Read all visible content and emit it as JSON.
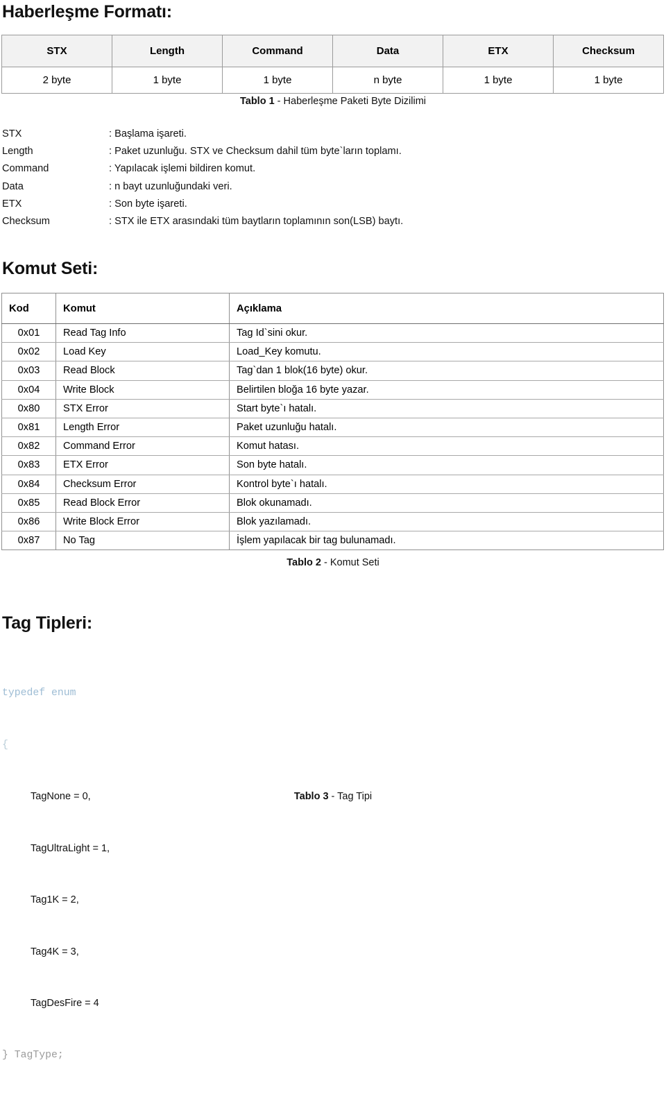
{
  "document": {
    "language": "tr"
  },
  "sections": {
    "packet_format": {
      "heading": "Haberleşme Formatı:",
      "table": {
        "headers": [
          "STX",
          "Length",
          "Command",
          "Data",
          "ETX",
          "Checksum"
        ],
        "row": [
          "2 byte",
          "1 byte",
          "1 byte",
          "n byte",
          "1 byte",
          "1 byte"
        ]
      },
      "caption": {
        "label": "Tablo 1",
        "separator": " - ",
        "text": "Haberleşme Paketi Byte Dizilimi"
      },
      "definitions": [
        {
          "term": "STX",
          "desc": ": Başlama işareti."
        },
        {
          "term": "Length",
          "desc": ": Paket uzunluğu. STX ve Checksum dahil tüm byte`ların toplamı."
        },
        {
          "term": "Command",
          "desc": ": Yapılacak işlemi bildiren komut."
        },
        {
          "term": "Data",
          "desc": ": n bayt uzunluğundaki veri."
        },
        {
          "term": "ETX",
          "desc": ": Son byte işareti."
        },
        {
          "term": "Checksum",
          "desc": ": STX ile ETX arasındaki tüm baytların toplamının son(LSB) baytı."
        }
      ]
    },
    "command_set": {
      "heading": "Komut Seti:",
      "table": {
        "headers": [
          "Kod",
          "Komut",
          "Açıklama"
        ],
        "rows": [
          [
            "0x01",
            "Read Tag Info",
            "Tag Id`sini okur."
          ],
          [
            "0x02",
            "Load Key",
            "Load_Key komutu."
          ],
          [
            "0x03",
            "Read Block",
            "Tag`dan 1 blok(16 byte) okur."
          ],
          [
            "0x04",
            "Write Block",
            "Belirtilen bloğa 16 byte yazar."
          ],
          [
            "0x80",
            "STX Error",
            "Start byte`ı hatalı."
          ],
          [
            "0x81",
            "Length Error",
            "Paket uzunluğu hatalı."
          ],
          [
            "0x82",
            "Command Error",
            "Komut hatası."
          ],
          [
            "0x83",
            "ETX Error",
            "Son byte hatalı."
          ],
          [
            "0x84",
            "Checksum Error",
            "Kontrol byte`ı hatalı."
          ],
          [
            "0x85",
            "Read Block Error",
            "Blok okunamadı."
          ],
          [
            "0x86",
            "Write Block Error",
            "Blok yazılamadı."
          ],
          [
            "0x87",
            "No Tag",
            "İşlem yapılacak bir tag bulunamadı."
          ]
        ]
      },
      "caption": {
        "label": "Tablo 2",
        "separator": " - ",
        "text": "Komut Seti"
      }
    },
    "tag_types": {
      "heading": "Tag Tipleri:",
      "code": {
        "line_typedef": "typedef enum",
        "line_open_brace": "{",
        "members": [
          "TagNone = 0,",
          "TagUltraLight = 1,",
          "Tag1K = 2,",
          "Tag4K = 3,",
          "TagDesFire = 4"
        ],
        "line_close": "} TagType;"
      },
      "caption": {
        "label": "Tablo 3",
        "separator": " - ",
        "text": "Tag Tipi"
      }
    }
  },
  "colors": {
    "text": "#111111",
    "table_border": "#8f8f8f",
    "header_fill": "#f2f2f2",
    "code_keyword": "#9dbcd4",
    "code_close": "#9b9b9b"
  }
}
